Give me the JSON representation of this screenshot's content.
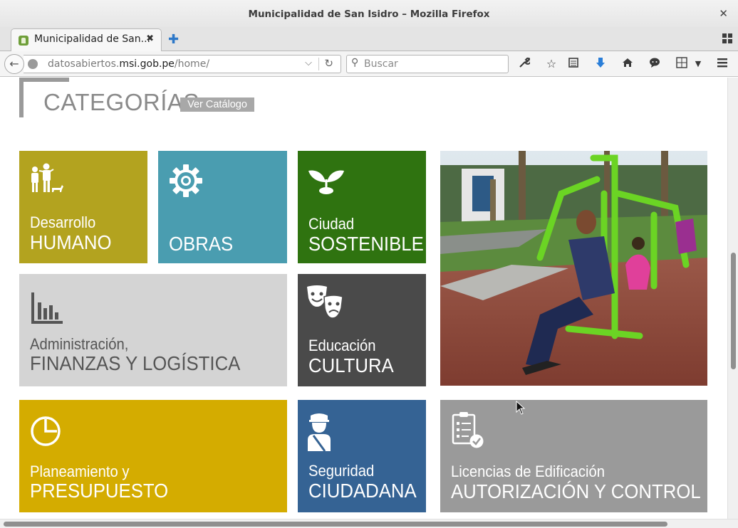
{
  "window": {
    "title": "Municipalidad de San Isidro – Mozilla Firefox",
    "close_glyph": "✕"
  },
  "tabs": [
    {
      "label": "Municipalidad de San...",
      "close_glyph": "✖",
      "icon": "municipal-crest-icon"
    }
  ],
  "toolbar": {
    "new_tab_glyph": "✚",
    "url_prefix": "datosabiertos.",
    "url_domain": "msi.gob.pe",
    "url_path": "/home/",
    "search_placeholder": "Buscar",
    "icons": [
      "back-icon",
      "globe-icon",
      "dropdown-icon",
      "reload-icon",
      "search-icon",
      "wrench-icon",
      "bookmark-star-icon",
      "reading-list-icon",
      "download-icon",
      "home-icon",
      "chat-icon",
      "window-icon",
      "menu-icon"
    ],
    "colors": {
      "download": "#2a7ed8",
      "new_tab": "#2d78c8"
    }
  },
  "page": {
    "heading": "CATEGORÍAS",
    "catalog_button": "Ver Catálogo",
    "tiles": [
      {
        "id": "humano",
        "line1": "Desarrollo",
        "line2": "HUMANO",
        "color": "#b3a31f",
        "icon": "family-icon"
      },
      {
        "id": "obras",
        "line1": "",
        "line2": "OBRAS",
        "color": "#4a9db0",
        "icon": "gear-icon"
      },
      {
        "id": "sostenible",
        "line1": "Ciudad",
        "line2": "SOSTENIBLE",
        "color": "#2f7310",
        "icon": "sprout-icon"
      },
      {
        "id": "finanzas",
        "line1": "Administración,",
        "line2": "FINANZAS Y LOGÍSTICA",
        "color": "#d4d4d4",
        "text_color": "#555555",
        "icon": "bar-chart-icon"
      },
      {
        "id": "cultura",
        "line1": "Educación",
        "line2": "CULTURA",
        "color": "#4a4a4a",
        "icon": "theater-masks-icon"
      },
      {
        "id": "presupuesto",
        "line1": "Planeamiento y",
        "line2": "PRESUPUESTO",
        "color": "#d4ac00",
        "icon": "pie-chart-icon"
      },
      {
        "id": "seguridad",
        "line1": "Seguridad",
        "line2": "CIUDADANA",
        "color": "#356394",
        "icon": "police-officer-icon"
      },
      {
        "id": "licencias",
        "line1": "Licencias de Edificación",
        "line2": "AUTORIZACIÓN Y CONTROL",
        "color": "#9a9a9a",
        "icon": "checklist-icon"
      }
    ],
    "photo": {
      "subject": "park-outdoor-gym-photo"
    }
  }
}
